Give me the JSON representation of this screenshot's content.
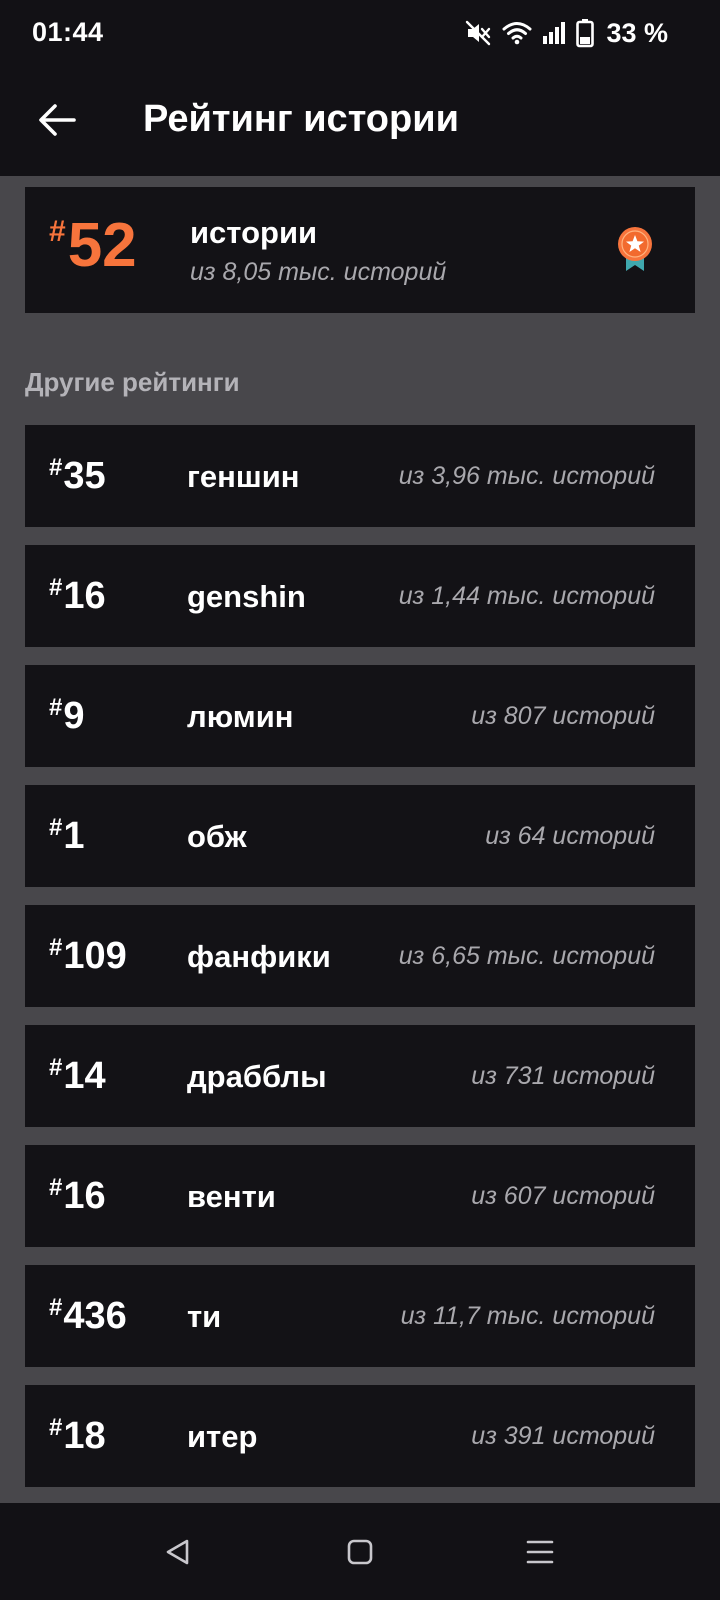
{
  "status_bar": {
    "time": "01:44",
    "battery": "33 %",
    "icons": [
      "mute-icon",
      "wifi-icon",
      "signal-icon",
      "battery-icon"
    ]
  },
  "app_bar": {
    "title": "Рейтинг истории",
    "back_icon": "arrow-left-icon"
  },
  "main_rating": {
    "hash": "#",
    "rank": "52",
    "tag": "истории",
    "subtitle": "из 8,05 тыс. историй",
    "icon": "medal-star-icon"
  },
  "other_ratings": {
    "title": "Другие рейтинги",
    "items": [
      {
        "hash": "#",
        "rank": "35",
        "tag": "геншин",
        "count": "из 3,96 тыс. историй"
      },
      {
        "hash": "#",
        "rank": "16",
        "tag": "genshin",
        "count": "из 1,44 тыс. историй"
      },
      {
        "hash": "#",
        "rank": "9",
        "tag": "люмин",
        "count": "из 807 историй"
      },
      {
        "hash": "#",
        "rank": "1",
        "tag": "обж",
        "count": "из 64 историй"
      },
      {
        "hash": "#",
        "rank": "109",
        "tag": "фанфики",
        "count": "из 6,65 тыс. историй"
      },
      {
        "hash": "#",
        "rank": "14",
        "tag": "драбблы",
        "count": "из 731 историй"
      },
      {
        "hash": "#",
        "rank": "16",
        "tag": "венти",
        "count": "из 607 историй"
      },
      {
        "hash": "#",
        "rank": "436",
        "tag": "ти",
        "count": "из 11,7 тыс. историй"
      },
      {
        "hash": "#",
        "rank": "18",
        "tag": "итер",
        "count": "из 391 историй"
      }
    ]
  },
  "nav_bar": {
    "icons": [
      "nav-back-icon",
      "nav-home-icon",
      "nav-recents-icon"
    ]
  },
  "colors": {
    "accent": "#f7743c",
    "card_bg": "#131216",
    "page_bg": "#48474b",
    "bar_bg": "#121115",
    "muted_text": "#a9a8ad"
  }
}
